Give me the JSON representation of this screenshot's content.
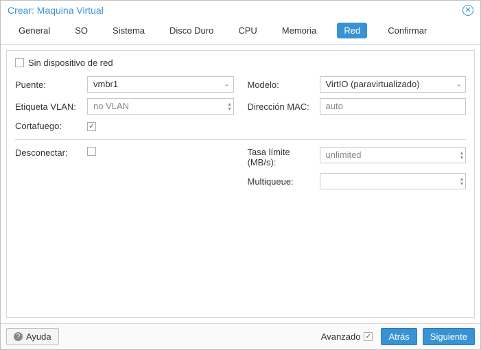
{
  "window": {
    "title": "Crear: Maquina Virtual"
  },
  "tabs": {
    "general": "General",
    "so": "SO",
    "sistema": "Sistema",
    "disco": "Disco Duro",
    "cpu": "CPU",
    "memoria": "Memoria",
    "red": "Red",
    "confirmar": "Confirmar"
  },
  "form": {
    "no_device_label": "Sin dispositivo de red",
    "no_device_checked": false,
    "bridge_label": "Puente:",
    "bridge_value": "vmbr1",
    "vlan_label": "Etiqueta VLAN:",
    "vlan_value": "no VLAN",
    "firewall_label": "Cortafuego:",
    "firewall_checked": true,
    "model_label": "Modelo:",
    "model_value": "VirtIO (paravirtualizado)",
    "mac_label": "Dirección MAC:",
    "mac_value": "auto",
    "disconnect_label": "Desconectar:",
    "disconnect_checked": false,
    "rate_label": "Tasa límite (MB/s):",
    "rate_value": "unlimited",
    "multiqueue_label": "Multiqueue:",
    "multiqueue_value": ""
  },
  "footer": {
    "help": "Ayuda",
    "advanced": "Avanzado",
    "advanced_checked": true,
    "back": "Atrás",
    "next": "Siguiente"
  }
}
